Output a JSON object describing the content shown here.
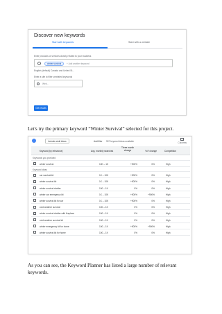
{
  "discover": {
    "title": "Discover new keywords",
    "tabs": [
      "Start with keywords",
      "Start with a website"
    ],
    "hint": "Enter products or services closely related to your business",
    "chip": "winter survival",
    "add_more_placeholder": "+ Add another keyword",
    "language_location": "English (default)    Canada and United St...",
    "site_label": "Enter a site to filter unrelated keywords",
    "site_placeholder": "Web...",
    "get_results": "Get results"
  },
  "paragraph1": "Let's try the primary keyword “Winter Survival” selected for this project.",
  "keyword_table": {
    "include_label": "Include adult ideas",
    "add_filter": "Add filter",
    "ideas_available": "957 keyword ideas available",
    "columns_label": "Columns",
    "headers": [
      "Keyword (by relevance)",
      "Avg. monthly searches",
      "Three month change",
      "YoY change",
      "Competition"
    ],
    "section_provided": "Keywords you provided",
    "provided_rows": [
      {
        "keyword": "winter survival",
        "avg": "10K – 1K",
        "three": "+900%",
        "yoy": "0%",
        "comp": "High"
      }
    ],
    "section_ideas": "Keyword ideas",
    "idea_rows": [
      {
        "keyword": "car survival kit",
        "avg": "1K – 10K",
        "three": "+900%",
        "yoy": "0%",
        "comp": "High"
      },
      {
        "keyword": "winter survival kit",
        "avg": "1K – 10K",
        "three": "+900%",
        "yoy": "0%",
        "comp": "High"
      },
      {
        "keyword": "winter survival shelter",
        "avg": "100 – 1K",
        "three": "0%",
        "yoy": "0%",
        "comp": "High"
      },
      {
        "keyword": "winter car emergency kit",
        "avg": "1K – 10K",
        "three": "+900%",
        "yoy": "+900%",
        "comp": "High"
      },
      {
        "keyword": "winter survival kit for car",
        "avg": "1K – 10K",
        "three": "+900%",
        "yoy": "0%",
        "comp": "High"
      },
      {
        "keyword": "cold weather survival",
        "avg": "100 – 1K",
        "three": "0%",
        "yoy": "0%",
        "comp": "High"
      },
      {
        "keyword": "winter survival shelter with fireplace",
        "avg": "100 – 1K",
        "three": "0%",
        "yoy": "0%",
        "comp": "High"
      },
      {
        "keyword": "cold weather survival kit",
        "avg": "100 – 1K",
        "three": "0%",
        "yoy": "0%",
        "comp": "High"
      },
      {
        "keyword": "winter emergency kit for home",
        "avg": "100 – 1K",
        "three": "+900%",
        "yoy": "+900%",
        "comp": "High"
      },
      {
        "keyword": "winter survival kit for home",
        "avg": "100 – 1K",
        "three": "0%",
        "yoy": "0%",
        "comp": "High"
      }
    ]
  },
  "paragraph2": "As you can see, the Keyword Planner has listed a large number of relevant keywords."
}
